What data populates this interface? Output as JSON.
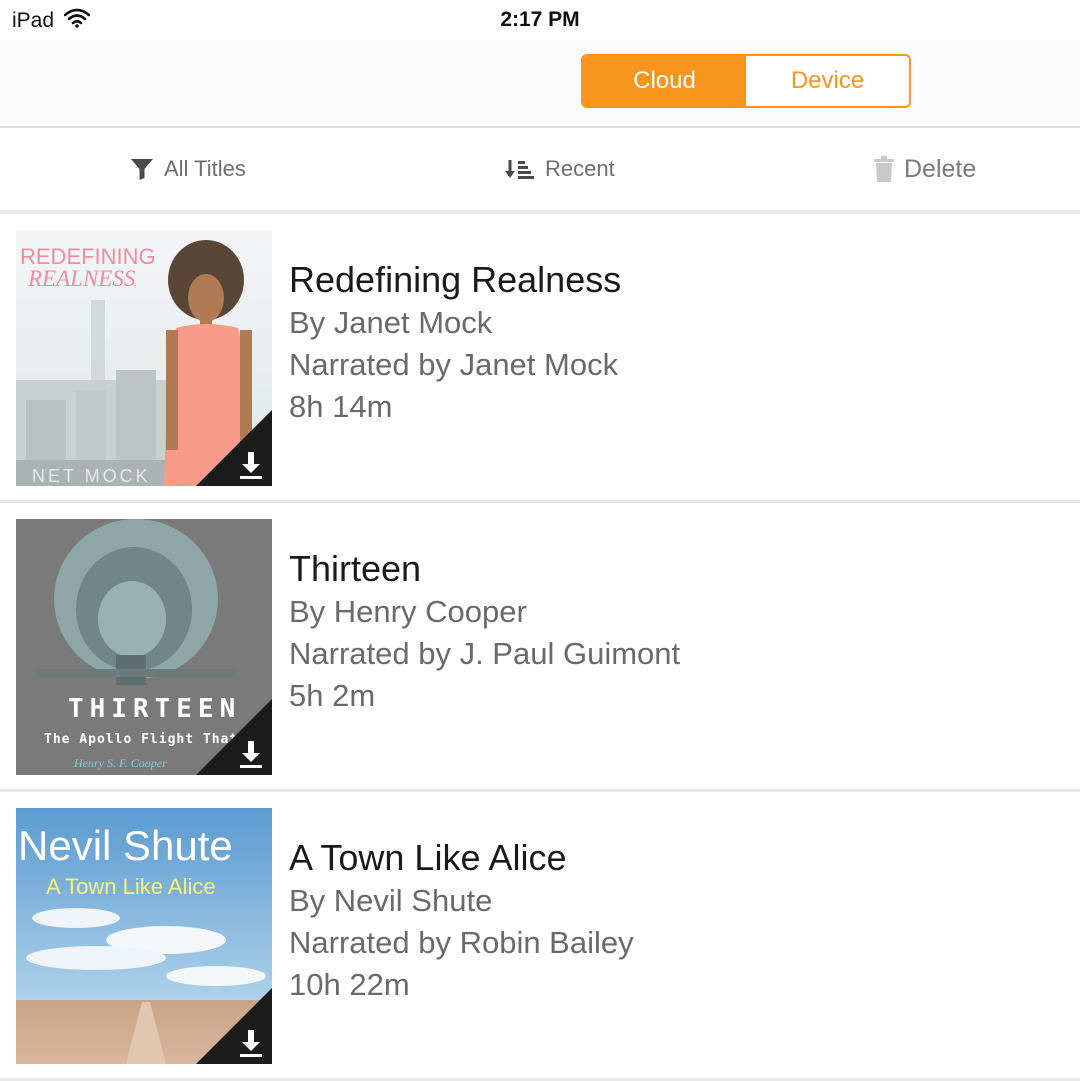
{
  "status": {
    "device": "iPad",
    "time": "2:17 PM"
  },
  "segmented": {
    "options": [
      "Cloud",
      "Device"
    ],
    "selected": "Cloud"
  },
  "toolbar": {
    "filter_label": "All Titles",
    "sort_label": "Recent",
    "delete_label": "Delete"
  },
  "colors": {
    "accent": "#f7941d",
    "divider": "#e6e6e6"
  },
  "books": [
    {
      "title": "Redefining Realness",
      "author": "By Janet Mock",
      "narrator": "Narrated by Janet Mock",
      "duration": "8h 14m",
      "cover": {
        "line1": "REDEFINING",
        "line2": "REALNESS",
        "footer": "NET MOCK"
      },
      "icon": "download-icon"
    },
    {
      "title": "Thirteen",
      "author": "By Henry Cooper",
      "narrator": "Narrated by J. Paul Guimont",
      "duration": "5h 2m",
      "cover": {
        "line1": "THIRTEEN",
        "line2": "The Apollo Flight That Faile",
        "footer": "Henry S. F. Cooper"
      },
      "icon": "download-icon"
    },
    {
      "title": "A Town Like Alice",
      "author": "By Nevil Shute",
      "narrator": "Narrated by Robin Bailey",
      "duration": "10h 22m",
      "cover": {
        "line1": "Nevil Shute",
        "line2": "A Town Like Alice",
        "footer": ""
      },
      "icon": "download-icon"
    }
  ]
}
